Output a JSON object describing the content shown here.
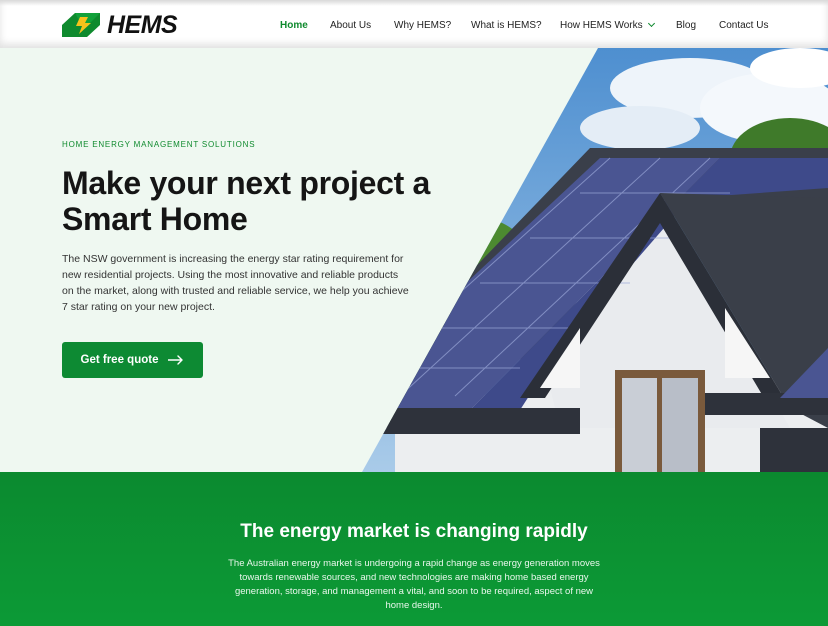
{
  "brand": {
    "name": "HEMS",
    "color_green": "#0f8a2e",
    "color_yellow": "#f7c21b"
  },
  "nav": {
    "items": [
      {
        "label": "Home",
        "active": true
      },
      {
        "label": "About Us"
      },
      {
        "label": "Why HEMS?"
      },
      {
        "label": "What is HEMS?"
      },
      {
        "label": "How HEMS Works",
        "has_dropdown": true
      },
      {
        "label": "Blog"
      },
      {
        "label": "Contact Us"
      }
    ]
  },
  "hero": {
    "eyebrow": "HOME ENERGY MANAGEMENT SOLUTIONS",
    "title": "Make your next project a Smart Home",
    "body": "The NSW government is increasing the energy star rating requirement for new residential projects. Using the most innovative and reliable products on the market, along with trusted and reliable service, we help you achieve 7 star rating on your new project.",
    "cta_label": "Get free quote",
    "cta_icon": "arrow-right-icon",
    "image": "house-with-solar-panels-photo"
  },
  "band": {
    "title": "The energy market is changing rapidly",
    "body": "The Australian energy market is undergoing a rapid change as energy generation moves towards renewable sources, and new technologies are making home based energy generation, storage, and management a vital, and soon to be required, aspect of new home design."
  }
}
